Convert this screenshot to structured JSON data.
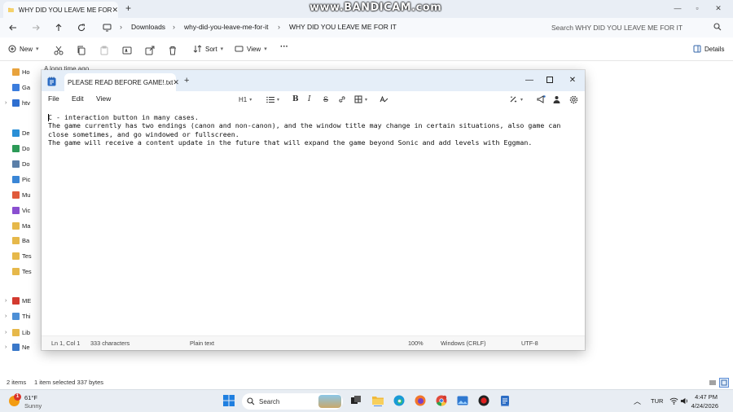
{
  "explorer": {
    "tab_title": "WHY DID YOU LEAVE ME FOR",
    "new_tab": "+",
    "breadcrumb": [
      "Downloads",
      "why-did-you-leave-me-for-it",
      "WHY DID YOU LEAVE ME FOR IT"
    ],
    "search_placeholder": "Search WHY DID YOU LEAVE ME FOR IT",
    "new_label": "New",
    "sort_label": "Sort",
    "view_label": "View",
    "more_label": "···",
    "details_label": "Details",
    "behind_text": "A long time ago",
    "nav_items": [
      {
        "label": "Ho",
        "color": "#e8a33d",
        "arrow": ""
      },
      {
        "label": "Ga",
        "color": "#3b7ddd",
        "arrow": ""
      },
      {
        "label": "htv",
        "color": "#2f6fd0",
        "arrow": "›"
      },
      {
        "label": "De",
        "color": "#2a8fd6",
        "arrow": ""
      },
      {
        "label": "Do",
        "color": "#2c9a57",
        "arrow": ""
      },
      {
        "label": "Do",
        "color": "#5b7fa8",
        "arrow": ""
      },
      {
        "label": "Pic",
        "color": "#3a86d6",
        "arrow": ""
      },
      {
        "label": "Mu",
        "color": "#e05a3b",
        "arrow": ""
      },
      {
        "label": "Vic",
        "color": "#8a4fd0",
        "arrow": ""
      },
      {
        "label": "Ma",
        "color": "#e6b84a",
        "arrow": ""
      },
      {
        "label": "Ba",
        "color": "#e6b84a",
        "arrow": ""
      },
      {
        "label": "Tes",
        "color": "#e6b84a",
        "arrow": ""
      },
      {
        "label": "Tes",
        "color": "#e6b84a",
        "arrow": ""
      },
      {
        "label": "ME",
        "color": "#d33a2f",
        "arrow": "›"
      },
      {
        "label": "Thi",
        "color": "#4d8fd6",
        "arrow": "›"
      },
      {
        "label": "Lib",
        "color": "#e6b84a",
        "arrow": "›"
      },
      {
        "label": "Ne",
        "color": "#3a78c9",
        "arrow": "›"
      }
    ],
    "status_items": "2 items",
    "status_selected": "1 item selected  337 bytes"
  },
  "notepad": {
    "tab_title": "PLEASE READ BEFORE GAME!.txt",
    "new_tab": "+",
    "menu": [
      "File",
      "Edit",
      "View"
    ],
    "heading_label": "H1",
    "bold_label": "B",
    "italic_label": "I",
    "strike_label": "S",
    "content": "C - interaction button in many cases.\nThe game currently has two endings (canon and non-canon), and the window title may change in certain situations, also game can\nclose sometimes, and go windowed or fullscreen.\nThe game will receive a content update in the future that will expand the game beyond Sonic and add levels with Eggman.",
    "status": {
      "position": "Ln 1, Col 1",
      "characters": "333 characters",
      "format": "Plain text",
      "zoom": "100%",
      "line_ending": "Windows (CRLF)",
      "encoding": "UTF-8"
    }
  },
  "taskbar": {
    "weather_temp": "61°F",
    "weather_condition": "Sunny",
    "weather_badge": "1",
    "search_label": "Search",
    "language": "TUR",
    "time": "4:47 PM",
    "date": "4/24/2026"
  },
  "overlay": {
    "watermark": "www.BANDICAM.com"
  }
}
